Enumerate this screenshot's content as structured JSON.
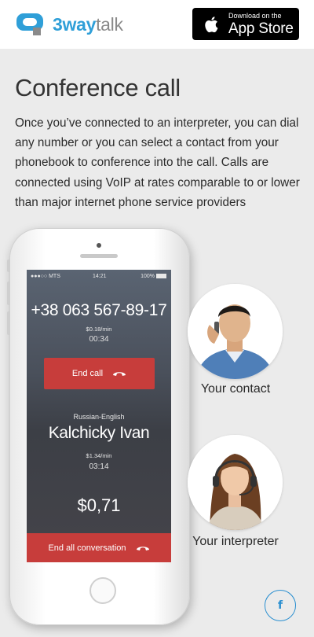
{
  "header": {
    "logo_main": "3way",
    "logo_light": "talk",
    "appstore_small": "Download on the",
    "appstore_big": "App Store"
  },
  "title": "Conference call",
  "description": "Once you’ve connected to an interpreter, you can dial any number or you can select a contact from your phonebook to conference into the call. Calls are connected using VoIP at rates comparable to or lower than major internet phone service providers",
  "phone": {
    "status": {
      "carrier": "●●●○○ MTS",
      "time": "14:21",
      "battery": "100%"
    },
    "contact_call": {
      "number": "+38 063 567-89-17",
      "rate": "$0.18/min",
      "duration": "00:34",
      "end_label": "End call"
    },
    "interpreter_call": {
      "language_pair": "Russian-English",
      "name": "Kalchicky Ivan",
      "rate": "$1.34/min",
      "duration": "03:14"
    },
    "total": "$0,71",
    "end_all_label": "End all conversation"
  },
  "contact": {
    "label": "Your contact"
  },
  "interpreter": {
    "label": "Your interpreter"
  },
  "social": {
    "facebook": "f"
  },
  "colors": {
    "brand": "#2f9fd8",
    "accent_red": "#c73d3b"
  }
}
